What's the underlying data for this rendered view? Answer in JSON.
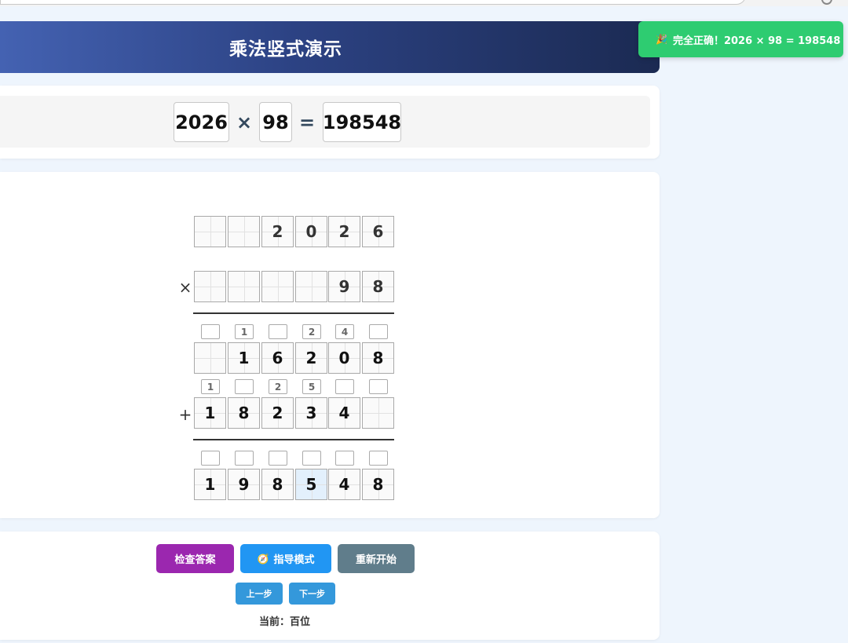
{
  "header": {
    "title": "乘法竖式演示"
  },
  "toast": {
    "icon": "party-popper-icon",
    "text": "完全正确！2026 × 98 = 198548",
    "color": "#2ecc71"
  },
  "equation": {
    "multiplicand": "2026",
    "times": "×",
    "multiplier": "98",
    "equals": "=",
    "answer": "198548"
  },
  "grid": {
    "row_multiplicand": [
      "",
      "",
      "2",
      "0",
      "2",
      "6"
    ],
    "times_sign": "×",
    "row_multiplier": [
      "",
      "",
      "",
      "",
      "9",
      "8"
    ],
    "carry_partial1": [
      "",
      "1",
      "",
      "2",
      "4",
      ""
    ],
    "row_partial1": [
      "",
      "1",
      "6",
      "2",
      "0",
      "8"
    ],
    "carry_partial2": [
      "1",
      "",
      "2",
      "5",
      "",
      ""
    ],
    "plus_sign": "+",
    "row_partial2": [
      "1",
      "8",
      "2",
      "3",
      "4",
      ""
    ],
    "carry_result": [
      "",
      "",
      "",
      "",
      "",
      ""
    ],
    "row_result": [
      "1",
      "9",
      "8",
      "5",
      "4",
      "8"
    ]
  },
  "controls": {
    "check_label": "检查答案",
    "guide_label": "指导模式",
    "guide_icon": "compass-icon",
    "restart_label": "重新开始",
    "prev_label": "上一步",
    "next_label": "下一步",
    "current_label": "当前：百位"
  },
  "colors": {
    "header_start": "#4462b2",
    "header_end": "#1b2a52",
    "check_button": "#9b27af",
    "guide_button": "#2196f3",
    "restart_button": "#607d8b",
    "step_button": "#3498db",
    "highlight_cell": "#e3f0fc"
  }
}
